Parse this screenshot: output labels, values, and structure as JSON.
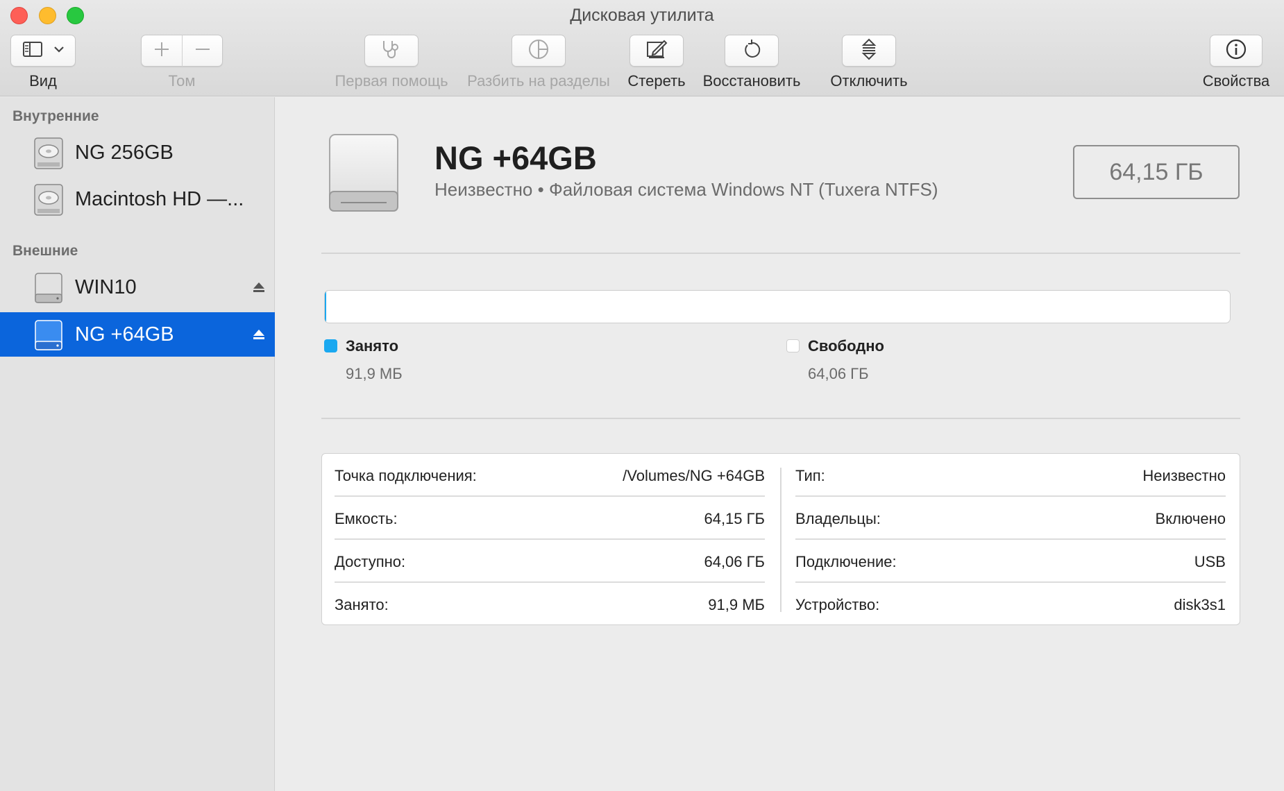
{
  "window": {
    "title": "Дисковая утилита"
  },
  "toolbar": {
    "view_label": "Вид",
    "volume_label": "Том",
    "first_aid_label": "Первая помощь",
    "partition_label": "Разбить на разделы",
    "erase_label": "Стереть",
    "restore_label": "Восстановить",
    "unmount_label": "Отключить",
    "info_label": "Свойства"
  },
  "sidebar": {
    "internal_header": "Внутренние",
    "external_header": "Внешние",
    "internal_items": [
      {
        "label": "NG 256GB"
      },
      {
        "label": "Macintosh HD —..."
      }
    ],
    "external_items": [
      {
        "label": "WIN10",
        "selected": false
      },
      {
        "label": "NG +64GB",
        "selected": true
      }
    ]
  },
  "volume": {
    "name": "NG +64GB",
    "subtitle": "Неизвестно • Файловая система Windows NT (Tuxera NTFS)",
    "capacity_badge": "64,15 ГБ",
    "used_fraction": 0.0014
  },
  "legend": {
    "used_label": "Занято",
    "used_value": "91,9 МБ",
    "free_label": "Свободно",
    "free_value": "64,06 ГБ"
  },
  "info": {
    "left": [
      {
        "key": "Точка подключения:",
        "value": "/Volumes/NG +64GB"
      },
      {
        "key": "Емкость:",
        "value": "64,15 ГБ"
      },
      {
        "key": "Доступно:",
        "value": "64,06 ГБ"
      },
      {
        "key": "Занято:",
        "value": "91,9 МБ"
      }
    ],
    "right": [
      {
        "key": "Тип:",
        "value": "Неизвестно"
      },
      {
        "key": "Владельцы:",
        "value": "Включено"
      },
      {
        "key": "Подключение:",
        "value": "USB"
      },
      {
        "key": "Устройство:",
        "value": "disk3s1"
      }
    ]
  },
  "colors": {
    "selection": "#0b65dc",
    "used": "#1aa8f0",
    "free": "#ffffff",
    "close": "#fe5f57",
    "minimize": "#febc2e",
    "zoom": "#28c840"
  }
}
